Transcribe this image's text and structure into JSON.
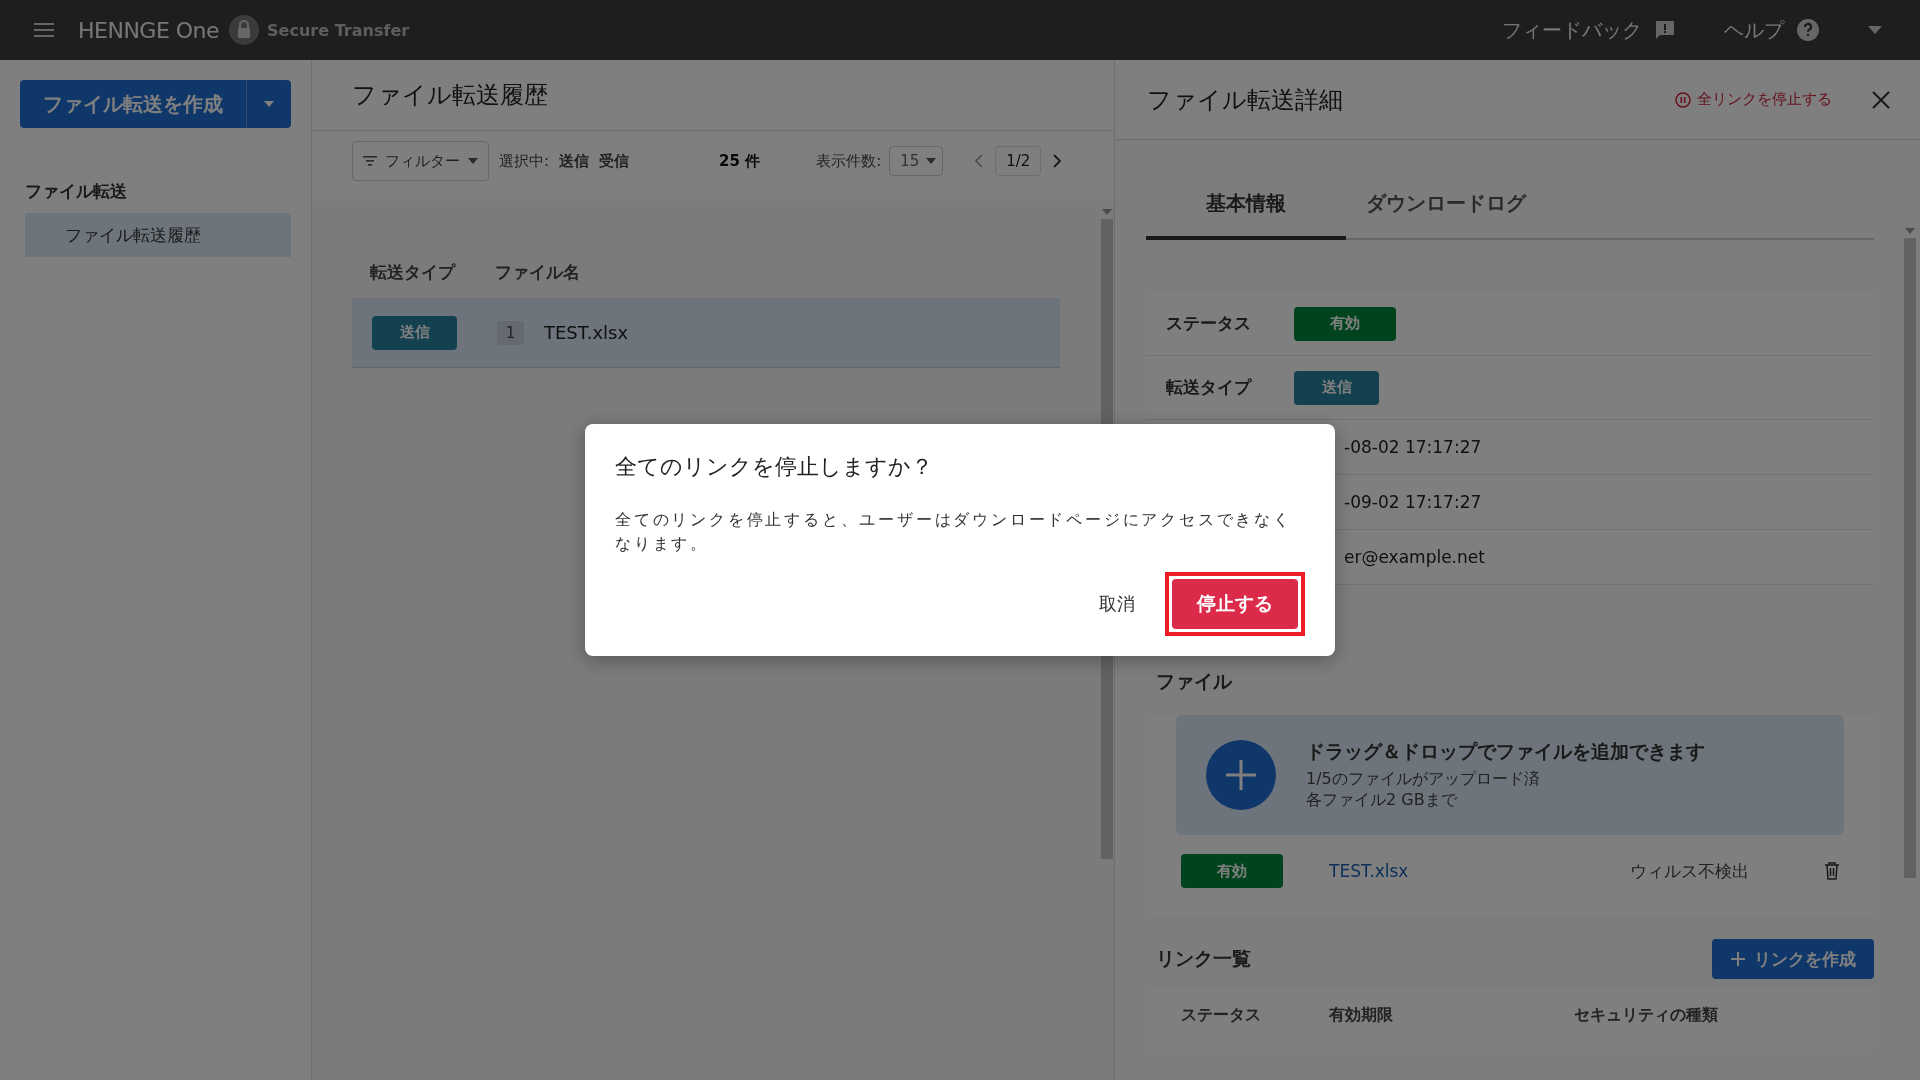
{
  "top_bar": {
    "brand": "HENNGE One",
    "product": "Secure Transfer",
    "links": [
      {
        "label": "フィードバック",
        "kind": "feedback"
      },
      {
        "label": "ヘルプ",
        "kind": "help"
      }
    ]
  },
  "sidebar": {
    "create_button": "ファイル転送を作成",
    "section": "ファイル転送",
    "items": [
      {
        "label": "ファイル転送履歴",
        "selected": true
      }
    ]
  },
  "history": {
    "title": "ファイル転送履歴",
    "filter": "フィルター",
    "selected_label": "選択中:",
    "selected_types": [
      "送信",
      "受信"
    ],
    "count": "25 件",
    "page_size_label": "表示件数:",
    "page_size": "15",
    "page": "1/2",
    "columns": [
      "転送タイプ",
      "ファイル名"
    ],
    "rows": [
      {
        "type": "送信",
        "file_count": "1",
        "file_name": "TEST.xlsx",
        "selected": true
      }
    ]
  },
  "detail": {
    "title": "ファイル転送詳細",
    "stop_all": "全リンクを停止する",
    "tabs": [
      {
        "label": "基本情報",
        "selected": true
      },
      {
        "label": "ダウンロードログ",
        "selected": false
      }
    ],
    "info_rows": [
      {
        "kind": "status_badge",
        "label": "ステータス",
        "value": "有効"
      },
      {
        "kind": "type_badge",
        "label": "転送タイプ",
        "value": "送信"
      },
      {
        "kind": "text",
        "value": "-08-02 17:17:27"
      },
      {
        "kind": "text",
        "value": "-09-02 17:17:27"
      },
      {
        "kind": "text",
        "value": "er@example.net"
      }
    ],
    "files_section": "ファイル",
    "dropzone": {
      "title": "ドラッグ＆ドロップでファイルを追加できます",
      "lines": [
        "1/5のファイルがアップロード済",
        "各ファイル2 GBまで"
      ]
    },
    "files": [
      {
        "status": "有効",
        "name": "TEST.xlsx",
        "scan": "ウィルス不検出"
      }
    ],
    "links_title": "リンク一覧",
    "create_link": "リンクを作成",
    "link_columns": [
      "ステータス",
      "有効期限",
      "セキュリティの種類"
    ]
  },
  "dialog": {
    "title": "全てのリンクを停止しますか？",
    "message": "全てのリンクを停止すると、ユーザーはダウンロードページにアクセスできなくなります。",
    "cancel": "取消",
    "confirm": "停止する",
    "confirm_highlighted": true
  }
}
